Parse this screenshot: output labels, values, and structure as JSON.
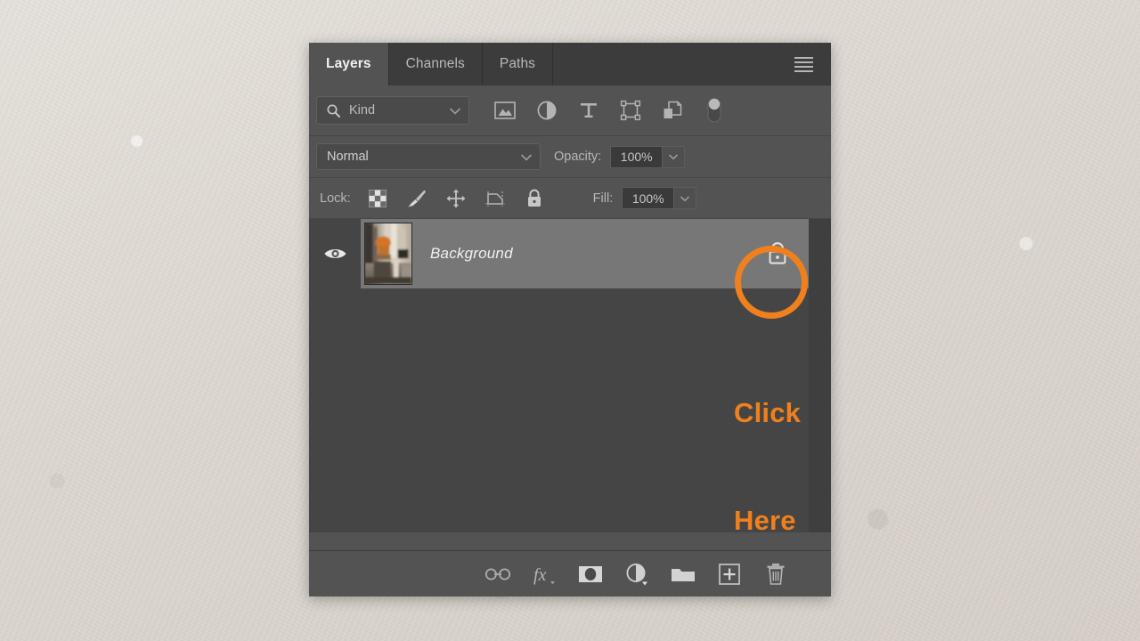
{
  "panel": {
    "tabs": [
      {
        "label": "Layers",
        "active": true,
        "name": "tab-layers"
      },
      {
        "label": "Channels",
        "active": false,
        "name": "tab-channels"
      },
      {
        "label": "Paths",
        "active": false,
        "name": "tab-paths"
      }
    ],
    "menu_icon": "hamburger-menu-icon"
  },
  "filter_row": {
    "search_icon": "search-icon",
    "kind_value": "Kind",
    "kind_chevron": "chevron-down-icon",
    "type_filters": [
      {
        "name": "filter-pixel-layers-icon",
        "title": "Pixel layers"
      },
      {
        "name": "filter-adjustment-layers-icon",
        "title": "Adjustment layers"
      },
      {
        "name": "filter-type-layers-icon",
        "title": "Type layers"
      },
      {
        "name": "filter-shape-layers-icon",
        "title": "Shape layers"
      },
      {
        "name": "filter-smart-objects-icon",
        "title": "Smart objects"
      }
    ],
    "toggle_icon": "filter-enable-toggle-icon"
  },
  "blend_row": {
    "blend_mode": "Normal",
    "blend_chevron": "chevron-down-icon",
    "opacity_label": "Opacity:",
    "opacity_value": "100%",
    "opacity_chevron": "chevron-down-icon"
  },
  "lock_row": {
    "lock_label": "Lock:",
    "lock_icons": [
      {
        "name": "lock-transparent-pixels-icon"
      },
      {
        "name": "lock-image-pixels-icon"
      },
      {
        "name": "lock-position-icon"
      },
      {
        "name": "lock-artboard-nesting-icon"
      },
      {
        "name": "lock-all-icon"
      }
    ],
    "fill_label": "Fill:",
    "fill_value": "100%",
    "fill_chevron": "chevron-down-icon"
  },
  "layers": [
    {
      "name": "Background",
      "visible": true,
      "locked": true,
      "visibility_icon": "eye-icon",
      "thumbnail_icon": "layer-thumbnail",
      "lock_icon": "layer-lock-icon"
    }
  ],
  "annotation": {
    "highlight_shape": "circle",
    "callout_line1": "Click",
    "callout_line2": "Here",
    "color": "#F0801E"
  },
  "bottom_toolbar": [
    {
      "name": "link-layers-icon",
      "label": "Link layers"
    },
    {
      "name": "layer-styles-fx-icon",
      "label": "Add a layer style"
    },
    {
      "name": "add-layer-mask-icon",
      "label": "Add layer mask"
    },
    {
      "name": "new-adjustment-layer-icon",
      "label": "New fill or adjustment layer"
    },
    {
      "name": "new-group-icon",
      "label": "Create a new group"
    },
    {
      "name": "new-layer-icon",
      "label": "Create a new layer"
    },
    {
      "name": "delete-layer-icon",
      "label": "Delete layer"
    }
  ],
  "colors": {
    "panel_bg": "#535353",
    "list_bg": "#454545",
    "row_selected": "#777777",
    "tab_inactive": "#3C3C3C",
    "accent_orange": "#F0801E"
  }
}
